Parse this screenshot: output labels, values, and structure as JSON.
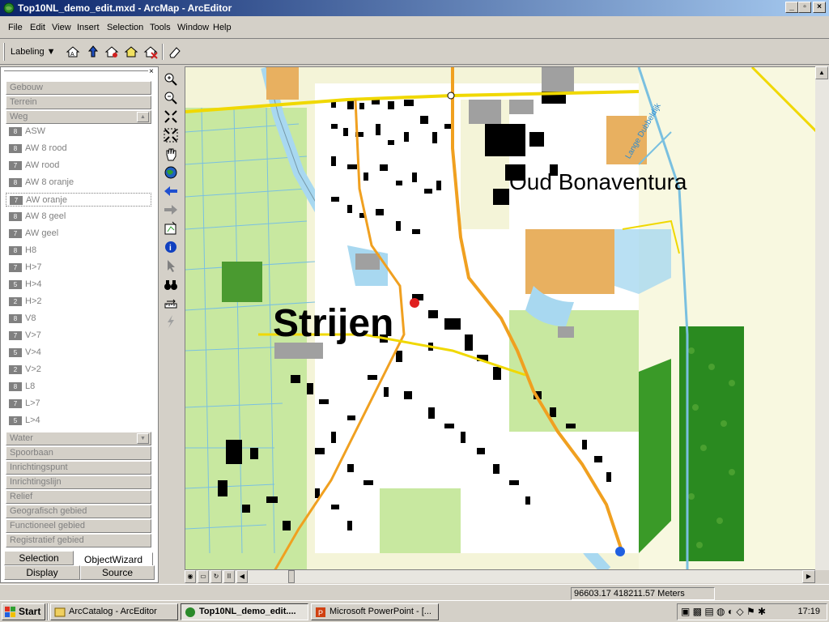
{
  "window": {
    "title": "Top10NL_demo_edit.mxd - ArcMap - ArcEditor"
  },
  "menu": [
    "File",
    "Edit",
    "View",
    "Insert",
    "Selection",
    "Tools",
    "Window",
    "Help"
  ],
  "toolbar": {
    "labeling_label": "Labeling"
  },
  "toc": {
    "top_headers": [
      "Gebouw",
      "Terrein",
      "Weg"
    ],
    "items": [
      {
        "sym": "8",
        "label": "ASW"
      },
      {
        "sym": "8",
        "label": "AW 8 rood"
      },
      {
        "sym": "7",
        "label": "AW rood"
      },
      {
        "sym": "8",
        "label": "AW 8 oranje"
      },
      {
        "sym": "7",
        "label": "AW oranje"
      },
      {
        "sym": "8",
        "label": "AW 8 geel"
      },
      {
        "sym": "7",
        "label": "AW geel"
      },
      {
        "sym": "8",
        "label": "H8"
      },
      {
        "sym": "7",
        "label": "H>7"
      },
      {
        "sym": "5",
        "label": "H>4"
      },
      {
        "sym": "2",
        "label": "H>2"
      },
      {
        "sym": "8",
        "label": "V8"
      },
      {
        "sym": "7",
        "label": "V>7"
      },
      {
        "sym": "5",
        "label": "V>4"
      },
      {
        "sym": "2",
        "label": "V>2"
      },
      {
        "sym": "8",
        "label": "L8"
      },
      {
        "sym": "7",
        "label": "L>7"
      },
      {
        "sym": "5",
        "label": "L>4"
      }
    ],
    "bottom_headers": [
      "Water",
      "Spoorbaan",
      "Inrichtingspunt",
      "Inrichtingslijn",
      "Relief",
      "Geografisch gebied",
      "Functioneel gebied",
      "Registratief gebied"
    ],
    "tabs": {
      "selection": "Selection",
      "objectwizard": "ObjectWizard",
      "display": "Display",
      "source": "Source"
    }
  },
  "map": {
    "label_town": "Strijen",
    "label_area": "Oud Bonaventura",
    "label_road": "Lange Dubbeldijk"
  },
  "status": {
    "coords": "96603.17  418211.57 Meters"
  },
  "taskbar": {
    "start": "Start",
    "tasks": [
      "ArcCatalog - ArcEditor",
      "Top10NL_demo_edit....",
      "Microsoft PowerPoint - [..."
    ],
    "clock": "17:19"
  },
  "colors": {
    "water": "#a8d8f0",
    "grass": "#b8e090",
    "forest": "#4a9a30",
    "road_main": "#f0a020",
    "road_minor": "#f0d800",
    "building": "#000000",
    "background": "#f4f4d8"
  }
}
